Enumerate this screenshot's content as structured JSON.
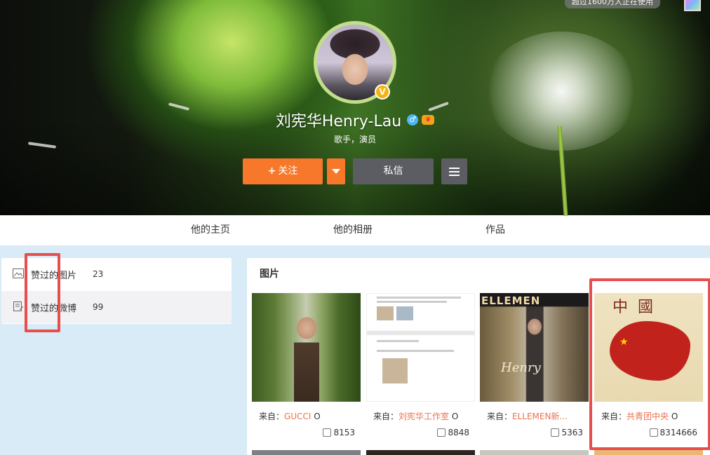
{
  "top_badge": "超过1600万人正在使用",
  "profile": {
    "name": "刘宪华Henry-Lau",
    "gender_symbol": "♂",
    "verified_mark": "V",
    "description": "歌手，演员"
  },
  "actions": {
    "follow_label": "关注",
    "follow_plus": "+",
    "message_label": "私信"
  },
  "tabs": [
    "他的主页",
    "他的相册",
    "作品"
  ],
  "sidebar": {
    "items": [
      {
        "label": "赞过的图片",
        "count": "23",
        "icon": "image-icon"
      },
      {
        "label": "赞过的微博",
        "count": "99",
        "icon": "weibo-doc-icon"
      }
    ]
  },
  "main": {
    "title": "图片",
    "from_prefix": "来自：",
    "cards": [
      {
        "source": "GUCCI",
        "suffix": " O",
        "likes": "8153"
      },
      {
        "source": "刘宪华工作室",
        "suffix": " O",
        "likes": "8848"
      },
      {
        "source": "ELLEMEN新...",
        "suffix": "",
        "likes": "5363"
      },
      {
        "source": "共青团中央",
        "suffix": " O",
        "likes": "8314666"
      }
    ],
    "card3_mag": "ELLEMEN",
    "card3_script": "Henry",
    "card4_title": "中國",
    "card4_star": "★"
  },
  "colors": {
    "accent_orange": "#f7782b",
    "dark_button": "#5b5d62",
    "link_orange": "#eb7350",
    "annotation_red": "#e74e4e"
  }
}
